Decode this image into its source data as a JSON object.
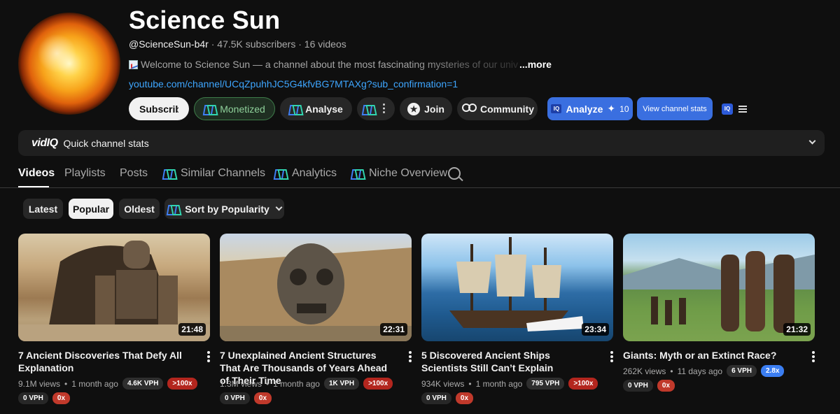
{
  "channel": {
    "title": "Science Sun",
    "handle": "@ScienceSun-b4r",
    "subscribers": "47.5K subscribers",
    "videos_count": "16 videos",
    "sep": "·",
    "description": "Welcome to Science Sun — a channel about the most fascinating mysteries of our univ",
    "more_label": "...more",
    "link": "youtube.com/channel/UCqZpuhhJC5G4kfvBG7MTAXg?sub_confirmation=1"
  },
  "actions": {
    "subscribe": "Subscribe",
    "monetized": "Monetized",
    "analyse": "Analyse",
    "join": "Join",
    "community": "Community",
    "analyze": "Analyze",
    "analyze_count": "10",
    "view_stats": "View channel stats",
    "iq_label": "IQ"
  },
  "stats_bar": {
    "logo": "vidIQ",
    "label": "Quick channel stats"
  },
  "tabs": {
    "videos": "Videos",
    "playlists": "Playlists",
    "posts": "Posts",
    "similar": "Similar Channels",
    "analytics": "Analytics",
    "niche": "Niche Overview"
  },
  "chips": {
    "latest": "Latest",
    "popular": "Popular",
    "oldest": "Oldest",
    "sort": "Sort by Popularity"
  },
  "videos": [
    {
      "title": "7 Ancient Discoveries That Defy All Explanation",
      "duration": "21:48",
      "views": "9.1M views",
      "age": "1 month ago",
      "vph": "4.6K VPH",
      "mult": ">100x",
      "vph2": "0 VPH",
      "mult2": "0x"
    },
    {
      "title": "7 Unexplained Ancient Structures That Are Thousands of Years Ahead of Their Time",
      "duration": "22:31",
      "views": "1.3M views",
      "age": "1 month ago",
      "vph": "1K VPH",
      "mult": ">100x",
      "vph2": "0 VPH",
      "mult2": "0x"
    },
    {
      "title": "5 Discovered Ancient Ships Scientists Still Can’t Explain",
      "duration": "23:34",
      "views": "934K views",
      "age": "1 month ago",
      "vph": "795 VPH",
      "mult": ">100x",
      "vph2": "0 VPH",
      "mult2": "0x"
    },
    {
      "title": "Giants: Myth or an Extinct Race?",
      "duration": "21:32",
      "views": "262K views",
      "age": "11 days ago",
      "vph": "6 VPH",
      "mult": "2.8x",
      "vph2": "0 VPH",
      "mult2": "0x"
    }
  ],
  "colors": {
    "background": "#0f0f0f",
    "link": "#3ea6ff",
    "accent_blue": "#3a6fe0",
    "badge_red": "#b3261e",
    "monetized_green": "#8fd19b"
  }
}
